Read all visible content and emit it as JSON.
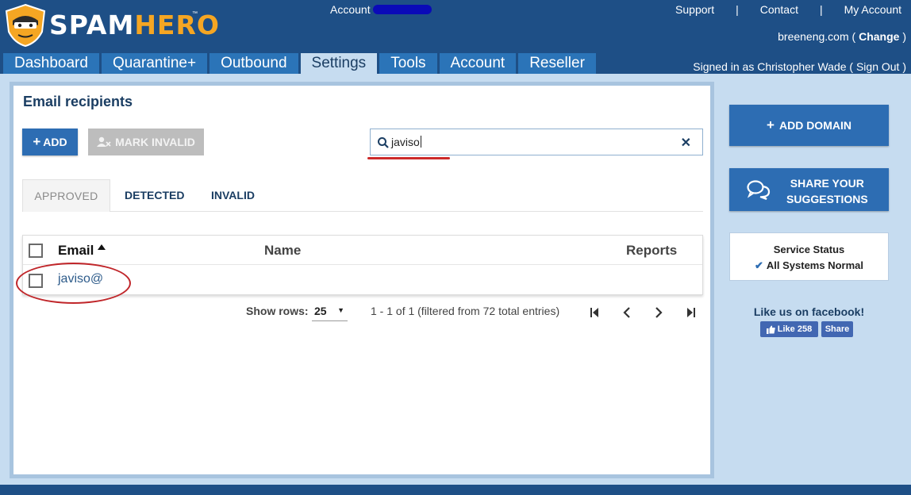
{
  "header": {
    "logo_text_spam": "SPAM",
    "logo_text_hero": "HERO",
    "logo_tm": "™",
    "account_label": "Account",
    "links": {
      "support": "Support",
      "contact": "Contact",
      "my_account": "My Account",
      "separator": "|"
    },
    "domain": "breeneng.com",
    "domain_open": " ( ",
    "change_label": "Change",
    "domain_close": " )",
    "signed_in": "Signed in as Christopher Wade ( Sign Out )"
  },
  "nav": {
    "tabs": [
      {
        "label": "Dashboard"
      },
      {
        "label": "Quarantine+"
      },
      {
        "label": "Outbound"
      },
      {
        "label": "Settings"
      },
      {
        "label": "Tools"
      },
      {
        "label": "Account"
      },
      {
        "label": "Reseller"
      }
    ],
    "active": "Settings"
  },
  "main": {
    "title": "Email recipients",
    "add_label": "ADD",
    "add_icon": "plus-icon",
    "mark_invalid_label": "MARK INVALID",
    "mark_invalid_icon": "user-x-icon",
    "search": {
      "value": "javiso",
      "clear": "✕"
    },
    "tabs": [
      {
        "label": "APPROVED"
      },
      {
        "label": "DETECTED"
      },
      {
        "label": "INVALID"
      }
    ],
    "table": {
      "columns": [
        "Email",
        "Name",
        "Reports"
      ],
      "rows": [
        {
          "email": "javiso@",
          "name": "",
          "reports": ""
        }
      ]
    },
    "pager": {
      "show_rows_label": "Show rows:",
      "rows_value": "25",
      "caret": "▼",
      "range": "1 - 1 of 1 (filtered from 72 total entries)"
    }
  },
  "sidebar": {
    "add_domain_label": "ADD DOMAIN",
    "share_line1": "SHARE YOUR",
    "share_line2": "SUGGESTIONS",
    "status_title": "Service Status",
    "status_text": "All Systems Normal",
    "facebook_title": "Like us on facebook!",
    "like_label": "Like 258",
    "share_label": "Share"
  },
  "colors": {
    "header_bg": "#1e4f86",
    "nav_tab": "#2b74b8",
    "content_bg": "#c6dcf0",
    "primary_button": "#2d6db3",
    "brand_orange": "#f5a623",
    "annotation_red": "#cc2a2a"
  }
}
